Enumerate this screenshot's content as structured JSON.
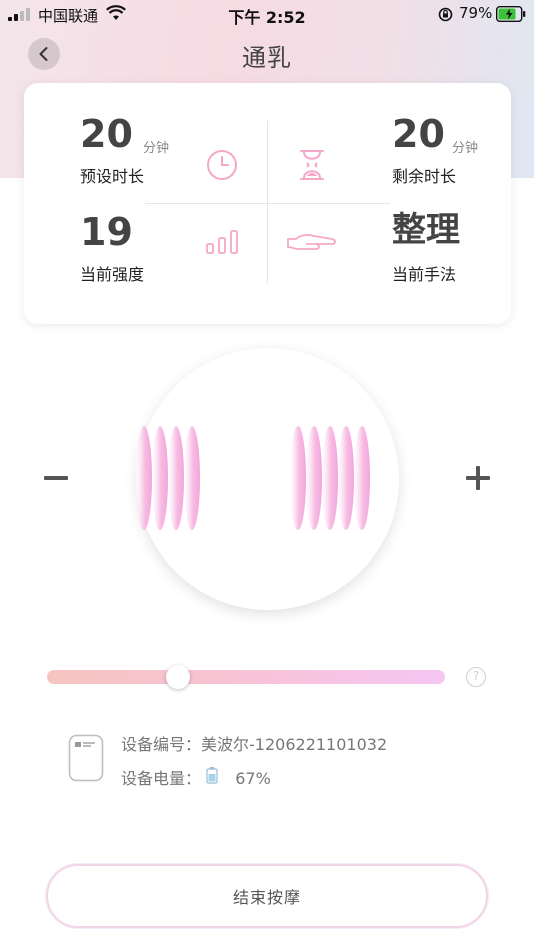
{
  "status_bar": {
    "carrier": "中国联通",
    "time": "下午 2:52",
    "battery_percent": "79%",
    "battery_level": 0.79
  },
  "header": {
    "title": "通乳"
  },
  "stats": {
    "preset_duration": {
      "value": "20",
      "unit": "分钟",
      "label": "预设时长"
    },
    "remaining_duration": {
      "value": "20",
      "unit": "分钟",
      "label": "剩余时长"
    },
    "current_intensity": {
      "value": "19",
      "label": "当前强度"
    },
    "current_technique": {
      "value": "整理",
      "label": "当前手法"
    }
  },
  "controls": {
    "minus": "−",
    "plus": "+",
    "slider_fraction": 0.33,
    "help": "?"
  },
  "device": {
    "number_label": "设备编号：",
    "number_value": "美波尔-1206221101032",
    "battery_label": "设备电量：",
    "battery_value": "67%"
  },
  "end_button": {
    "label": "结束按摩"
  },
  "colors": {
    "accent_pink": "#f4a7c6",
    "text_dark": "#444444",
    "text_muted": "#777777"
  }
}
